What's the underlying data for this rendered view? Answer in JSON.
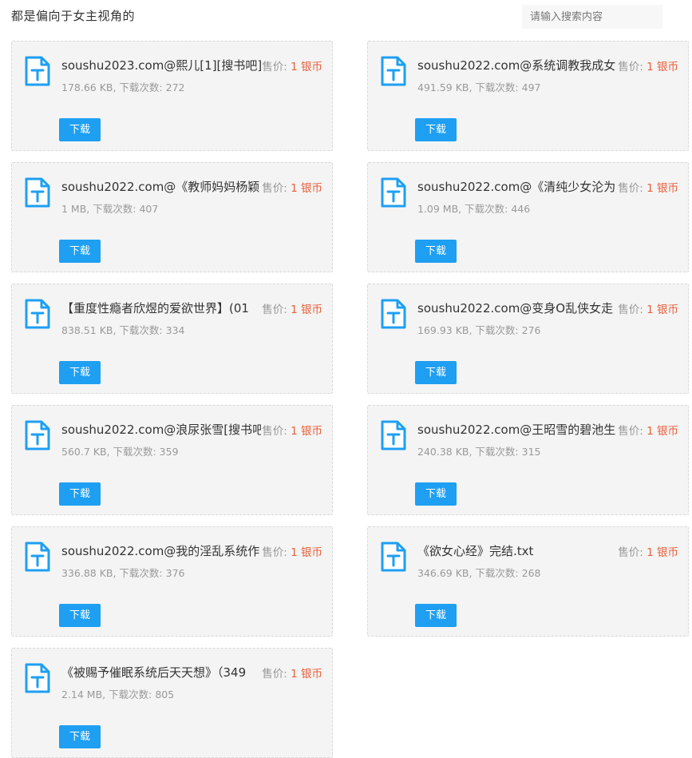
{
  "header": {
    "title": "都是偏向于女主视角的",
    "search_placeholder": "请输入搜索内容"
  },
  "labels": {
    "price_prefix": "售价: ",
    "download": "下载",
    "downloads_prefix": ", 下载次数: "
  },
  "icons": {
    "file": "text-file-icon"
  },
  "colors": {
    "accent": "#1e9ff2",
    "price": "#e8603c"
  },
  "files": [
    {
      "name": "soushu2023.com@熙儿[1][搜书吧]",
      "size": "178.66 KB",
      "downloads": "272",
      "price": "1 银币"
    },
    {
      "name": "soushu2022.com@系统调教我成女",
      "size": "491.59 KB",
      "downloads": "497",
      "price": "1 银币"
    },
    {
      "name": "soushu2022.com@《教师妈妈杨颖",
      "size": "1 MB",
      "downloads": "407",
      "price": "1 银币"
    },
    {
      "name": "soushu2022.com@《清纯少女沦为",
      "size": "1.09 MB",
      "downloads": "446",
      "price": "1 银币"
    },
    {
      "name": "【重度性瘾者欣煜的爱欲世界】(01",
      "size": "838.51 KB",
      "downloads": "334",
      "price": "1 银币"
    },
    {
      "name": "soushu2022.com@变身O乱侠女走",
      "size": "169.93 KB",
      "downloads": "276",
      "price": "1 银币"
    },
    {
      "name": "soushu2022.com@浪尿张雪[搜书吧",
      "size": "560.7 KB",
      "downloads": "359",
      "price": "1 银币"
    },
    {
      "name": "soushu2022.com@王昭雪的碧池生",
      "size": "240.38 KB",
      "downloads": "315",
      "price": "1 银币"
    },
    {
      "name": "soushu2022.com@我的淫乱系统作",
      "size": "336.88 KB",
      "downloads": "376",
      "price": "1 银币"
    },
    {
      "name": "《欲女心经》完结.txt",
      "size": "346.69 KB",
      "downloads": "268",
      "price": "1 银币"
    },
    {
      "name": "《被赐予催眠系统后天天想》（349",
      "size": "2.14 MB",
      "downloads": "805",
      "price": "1 银币"
    }
  ]
}
